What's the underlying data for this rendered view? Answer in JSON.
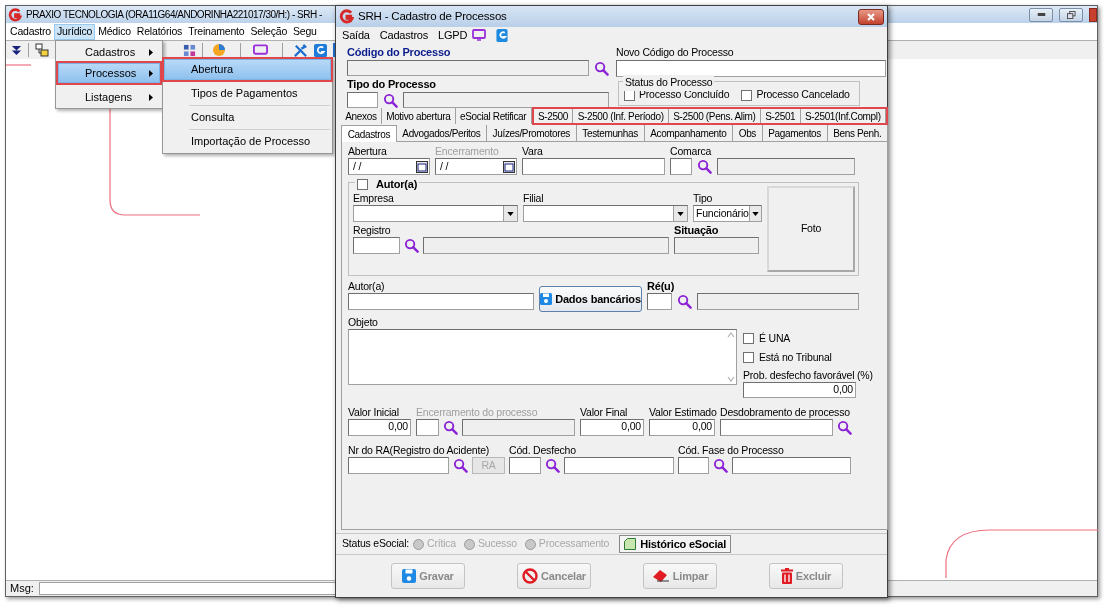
{
  "main_window": {
    "title": "PRAXIO TECNOLOGIA (ORA11G64/ANDORINHA221017/30/H:) - SRH -",
    "menu": [
      {
        "label": "Cadastro",
        "selected": false
      },
      {
        "label": "Jurídico",
        "selected": true
      },
      {
        "label": "Médico",
        "selected": false
      },
      {
        "label": "Relatórios",
        "selected": false
      },
      {
        "label": "Treinamento",
        "selected": false
      },
      {
        "label": "Seleção",
        "selected": false
      },
      {
        "label": "Segu",
        "selected": false
      }
    ],
    "status_label": "Msg:"
  },
  "menu_open": {
    "items": [
      {
        "label": "Cadastros",
        "selected": false,
        "annotated": false
      },
      {
        "label": "Processos",
        "selected": true,
        "annotated": true
      },
      {
        "label": "Listagens",
        "selected": false,
        "annotated": false
      }
    ]
  },
  "submenu": {
    "items": [
      {
        "label": "Abertura",
        "selected": true,
        "annotated": true
      },
      {
        "label": "Tipos de Pagamentos",
        "selected": false,
        "annotated": false
      },
      {
        "label": "Consulta",
        "selected": false,
        "annotated": false
      },
      {
        "label": "Importação de Processo",
        "selected": false,
        "annotated": false
      }
    ]
  },
  "dialog": {
    "title": "SRH - Cadastro de Processos",
    "menu": [
      "Saída",
      "Cadastros",
      "LGPD"
    ],
    "code_label": "Código do Processo",
    "new_code_label": "Novo Código do Processo",
    "type_label": "Tipo do Processo",
    "status_group": {
      "label": "Status do Processo",
      "checks": [
        {
          "label": "Processo Concluído",
          "checked": false
        },
        {
          "label": "Processo Cancelado",
          "checked": false
        }
      ]
    },
    "tabs_row_1": [
      {
        "label": "Anexos",
        "selected": false,
        "annotated": false
      },
      {
        "label": "Motivo abertura",
        "selected": false,
        "annotated": false
      },
      {
        "label": "eSocial Retificar",
        "selected": false,
        "annotated": false
      },
      {
        "label": "S-2500",
        "selected": false,
        "annotated": true
      },
      {
        "label": "S-2500 (Inf. Período)",
        "selected": false,
        "annotated": true
      },
      {
        "label": "S-2500 (Pens. Alim)",
        "selected": false,
        "annotated": true
      },
      {
        "label": "S-2501",
        "selected": false,
        "annotated": true
      },
      {
        "label": "S-2501(Inf.Compl)",
        "selected": false,
        "annotated": true
      }
    ],
    "tabs_row_2": [
      {
        "label": "Cadastros",
        "selected": true,
        "annotated": false
      },
      {
        "label": "Advogados/Peritos",
        "selected": false,
        "annotated": false
      },
      {
        "label": "Juízes/Promotores",
        "selected": false,
        "annotated": false
      },
      {
        "label": "Testemunhas",
        "selected": false,
        "annotated": false
      },
      {
        "label": "Acompanhamento",
        "selected": false,
        "annotated": false
      },
      {
        "label": "Obs",
        "selected": false,
        "annotated": false
      },
      {
        "label": "Pagamentos",
        "selected": false,
        "annotated": false
      },
      {
        "label": "Bens Penh.",
        "selected": false,
        "annotated": false
      }
    ],
    "dates": [
      {
        "label": "Abertura",
        "value": "/ /",
        "disabled": false
      },
      {
        "label": "Encerramento",
        "value": "/ /",
        "disabled": true
      }
    ],
    "vara_label": "Vara",
    "comarca_label": "Comarca",
    "author_group": {
      "label": "Autor(a)",
      "checked": false,
      "empresa_label": "Empresa",
      "filial_label": "Filial",
      "tipo_label": "Tipo",
      "tipo_value": "Funcionário",
      "registro_label": "Registro",
      "situacao_label": "Situação",
      "photo_label": "Foto"
    },
    "author_label": "Autor(a)",
    "bank_button": "Dados bancários",
    "defendant_label": "Ré(u)",
    "object_label": "Objeto",
    "flags": [
      {
        "label": "É UNA",
        "checked": false
      },
      {
        "label": "Está no Tribunal",
        "checked": false
      }
    ],
    "prob_label": "Prob. desfecho favorável (%)",
    "prob_value": "0,00",
    "values": {
      "initial_label": "Valor Inicial",
      "initial_value": "0,00",
      "closing_label": "Encerramento do processo",
      "final_label": "Valor Final",
      "final_value": "0,00",
      "estimated_label": "Valor Estimado",
      "estimated_value": "0,00",
      "split_label": "Desdobramento de processo"
    },
    "ra_label": "Nr do RA(Registro do Acidente)",
    "ra_button": {
      "label": "RA",
      "disabled": true
    },
    "outcome_label": "Cód. Desfecho",
    "phase_label": "Cód. Fase do Processo",
    "esocial": {
      "label": "Status eSocial:",
      "indicators": [
        "Crítica",
        "Sucesso",
        "Processamento"
      ],
      "history_button": "Histórico eSocial"
    },
    "buttons": [
      {
        "label": "Gravar",
        "kind": "save"
      },
      {
        "label": "Cancelar",
        "kind": "cancel"
      },
      {
        "label": "Limpar",
        "kind": "clear"
      },
      {
        "label": "Excluir",
        "kind": "delete"
      }
    ]
  }
}
